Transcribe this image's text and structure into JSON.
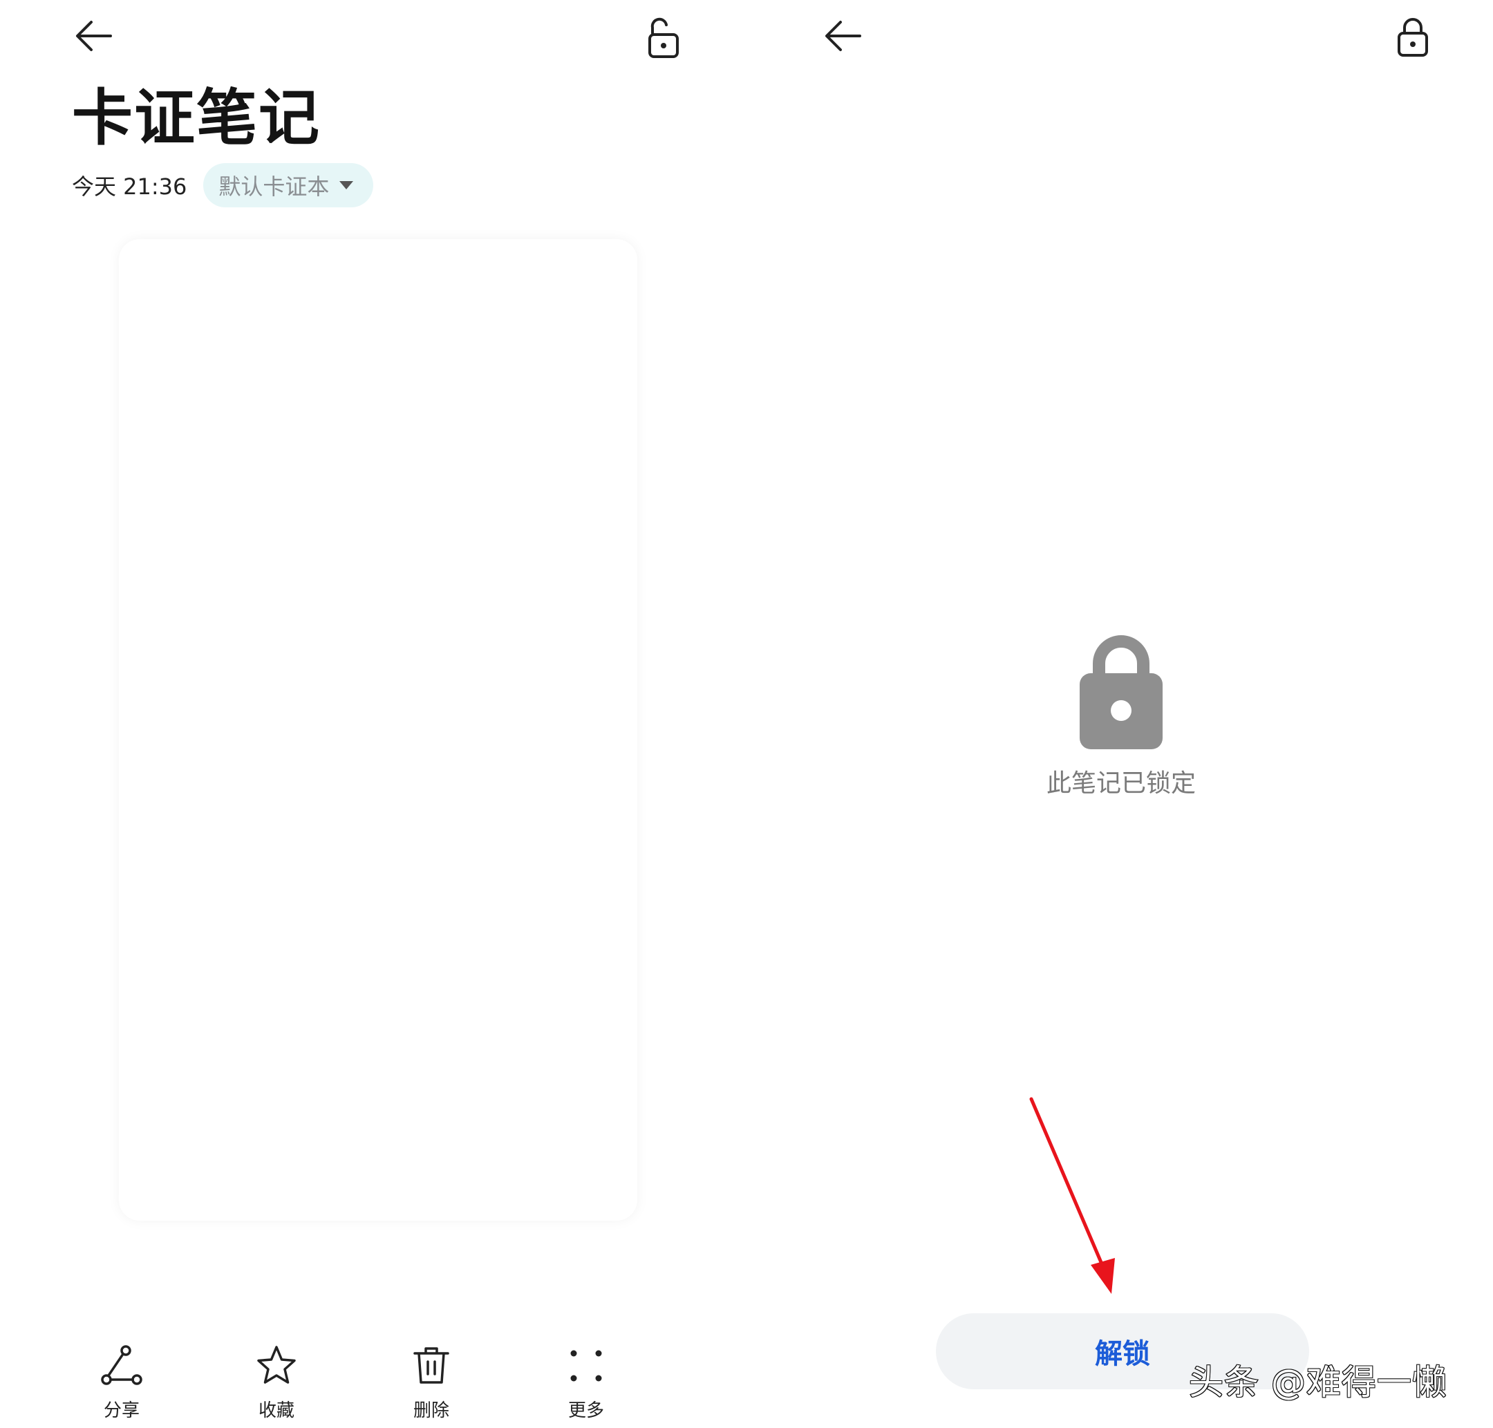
{
  "left_screen": {
    "title": "卡证笔记",
    "date": "今天 21:36",
    "category": "默认卡证本",
    "toolbar": [
      {
        "label": "分享",
        "icon": "share-icon"
      },
      {
        "label": "收藏",
        "icon": "star-icon"
      },
      {
        "label": "删除",
        "icon": "trash-icon"
      },
      {
        "label": "更多",
        "icon": "more-dots-icon"
      }
    ]
  },
  "right_screen": {
    "locked_message": "此笔记已锁定",
    "unlock_label": "解锁"
  },
  "watermark": "头条 @难得一懒",
  "colors": {
    "chip_background": "#e6f6f7",
    "unlock_text": "#1c5cd8",
    "unlock_background": "#f1f3f5",
    "lock_icon_gray": "#8f8f8f",
    "annotation_arrow": "#e8141c"
  }
}
